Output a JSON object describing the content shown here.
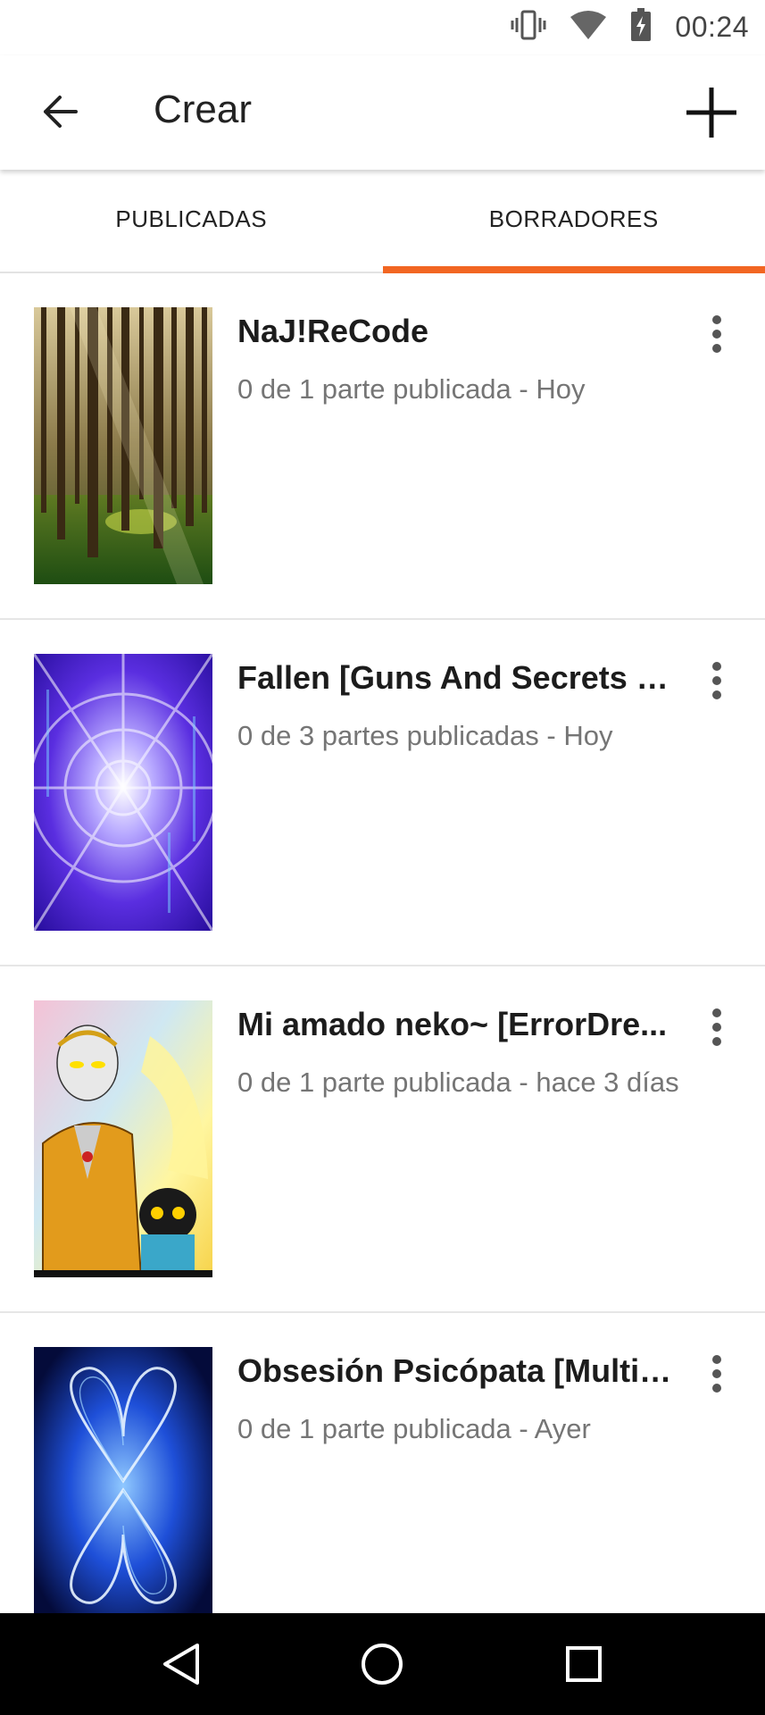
{
  "status_bar": {
    "time": "00:24",
    "icons": [
      "vibrate-icon",
      "wifi-icon",
      "battery-charging-icon"
    ]
  },
  "app_bar": {
    "title": "Crear",
    "back_icon": "arrow-left-icon",
    "add_icon": "plus-icon"
  },
  "tabs": [
    {
      "label": "PUBLICADAS",
      "active": false
    },
    {
      "label": "BORRADORES",
      "active": true
    }
  ],
  "accent_color": "#f26622",
  "stories": [
    {
      "title": "NaJ!ReCode",
      "meta": "0 de 1 parte publicada - Hoy",
      "cover": "forest"
    },
    {
      "title": "Fallen [Guns And Secrets S...",
      "meta": "0 de 3 partes publicadas - Hoy",
      "cover": "digital-tunnel"
    },
    {
      "title": "Mi amado neko~ [ErrorDre...",
      "meta": "0 de 1 parte publicada - hace 3 días",
      "cover": "anime-illustration"
    },
    {
      "title": "Obsesión Psicópata [Multis...",
      "meta": "0 de 1 parte publicada - Ayer",
      "cover": "blue-energy-hearts"
    }
  ],
  "nav_bar": [
    "back-triangle-icon",
    "home-circle-icon",
    "recents-square-icon"
  ]
}
